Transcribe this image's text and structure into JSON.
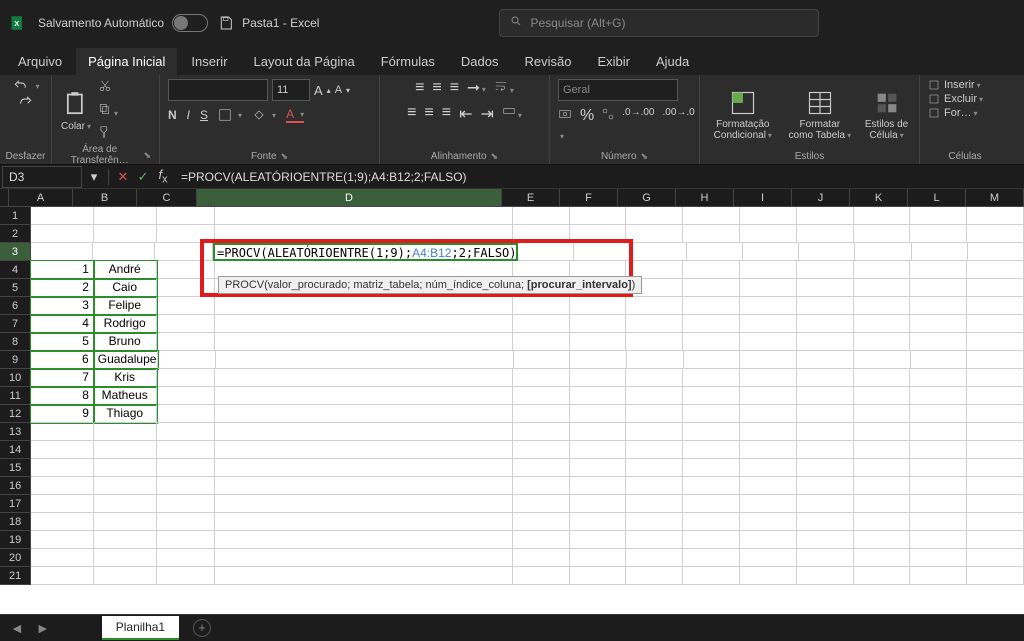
{
  "titlebar": {
    "autosave_label": "Salvamento Automático",
    "doc_title": "Pasta1  -  Excel",
    "search_placeholder": "Pesquisar (Alt+G)"
  },
  "menu": {
    "items": [
      "Arquivo",
      "Página Inicial",
      "Inserir",
      "Layout da Página",
      "Fórmulas",
      "Dados",
      "Revisão",
      "Exibir",
      "Ajuda"
    ],
    "active_index": 1
  },
  "ribbon": {
    "undo_label": "Desfazer",
    "clipboard_label": "Área de Transferên…",
    "paste_label": "Colar",
    "font_label": "Fonte",
    "font_size": "11",
    "alignment_label": "Alinhamento",
    "number_label": "Número",
    "number_format": "Geral",
    "styles_label": "Estilos",
    "cond_fmt": "Formatação Condicional",
    "table_fmt": "Formatar como Tabela",
    "cell_styles": "Estilos de Célula",
    "cells_label": "Células",
    "insert": "Inserir",
    "delete": "Excluir",
    "format": "For…"
  },
  "formula_bar": {
    "name_box": "D3",
    "formula": "=PROCV(ALEATÓRIOENTRE(1;9);A4:B12;2;FALSO)"
  },
  "columns": [
    "A",
    "B",
    "C",
    "D",
    "E",
    "F",
    "G",
    "H",
    "I",
    "J",
    "K",
    "L",
    "M"
  ],
  "col_widths": {
    "A": 64,
    "B": 64,
    "C": 60,
    "D": 305,
    "E": 58,
    "F": 58,
    "G": 58,
    "H": 58,
    "I": 58,
    "J": 58,
    "K": 58,
    "L": 58,
    "M": 58
  },
  "data_rows": [
    {
      "a": "1",
      "b": "André"
    },
    {
      "a": "2",
      "b": "Caio"
    },
    {
      "a": "3",
      "b": "Felipe"
    },
    {
      "a": "4",
      "b": "Rodrigo"
    },
    {
      "a": "5",
      "b": "Bruno"
    },
    {
      "a": "6",
      "b": "Guadalupe"
    },
    {
      "a": "7",
      "b": "Kris"
    },
    {
      "a": "8",
      "b": "Matheus"
    },
    {
      "a": "9",
      "b": "Thiago"
    }
  ],
  "edit_cell": {
    "prefix": "=PROCV(ALEATÓRIOENTRE(1;9);",
    "ref": "A4:B12",
    "suffix": ";2;FALSO)"
  },
  "formula_tip": {
    "fn": "PROCV",
    "args": "(valor_procurado; matriz_tabela; núm_índice_coluna; ",
    "current": "[procurar_intervalo]",
    "tail": ")"
  },
  "sheet_tabs": {
    "active": "Planilha1"
  },
  "total_rows": 21,
  "selected_col": "D",
  "selected_row": 3
}
